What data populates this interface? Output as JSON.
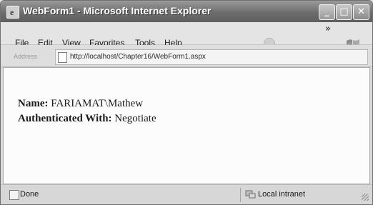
{
  "window": {
    "title": "WebForm1 - Microsoft Internet Explorer",
    "icon": "ie-page-icon",
    "controls": [
      "minimize",
      "maximize",
      "close"
    ]
  },
  "menu": {
    "items": [
      {
        "label": "File"
      },
      {
        "label": "Edit"
      },
      {
        "label": "View"
      },
      {
        "label": "Favorites"
      },
      {
        "label": "Tools"
      },
      {
        "label": "Help"
      }
    ]
  },
  "address": {
    "label": "Address",
    "url": "http://localhost/Chapter16/WebForm1.aspx"
  },
  "content": {
    "name_label": "Name:",
    "name_value": "FARIAMAT\\Mathew",
    "auth_label": "Authenticated With:",
    "auth_value": "Negotiate"
  },
  "status": {
    "text": "Done",
    "zone": "Local intranet"
  }
}
